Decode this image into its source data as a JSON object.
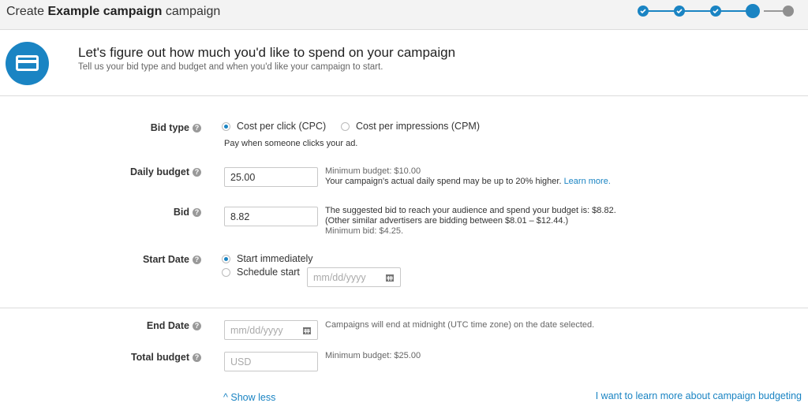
{
  "header": {
    "title_prefix": "Create",
    "campaign_name": "Example campaign",
    "title_suffix": "campaign",
    "steps": [
      {
        "state": "done"
      },
      {
        "state": "done"
      },
      {
        "state": "done"
      },
      {
        "state": "current"
      },
      {
        "state": "future"
      }
    ]
  },
  "intro": {
    "icon": "credit-card-icon",
    "heading": "Let's figure out how much you'd like to spend on your campaign",
    "subheading": "Tell us your bid type and budget and when you'd like your campaign to start."
  },
  "form": {
    "bid_type": {
      "label": "Bid type",
      "options": [
        "Cost per click (CPC)",
        "Cost per impressions (CPM)"
      ],
      "selected": "Cost per click (CPC)",
      "hint": "Pay when someone clicks your ad."
    },
    "daily_budget": {
      "label": "Daily budget",
      "value": "25.00",
      "hint_min": "Minimum budget: $10.00",
      "hint_text": "Your campaign's actual daily spend may be up to 20% higher.",
      "hint_link": "Learn more."
    },
    "bid": {
      "label": "Bid",
      "value": "8.82",
      "hint_line1": "The suggested bid to reach your audience and spend your budget is: $8.82.",
      "hint_line2": "(Other similar advertisers are bidding between $8.01 – $12.44.)",
      "hint_line3": "Minimum bid: $4.25."
    },
    "start_date": {
      "label": "Start Date",
      "options": [
        "Start immediately",
        "Schedule start"
      ],
      "selected": "Start immediately",
      "date_placeholder": "mm/dd/yyyy"
    },
    "end_date": {
      "label": "End Date",
      "placeholder": "mm/dd/yyyy",
      "hint": "Campaigns will end at midnight (UTC time zone) on the date selected."
    },
    "total_budget": {
      "label": "Total budget",
      "placeholder": "USD",
      "hint": "Minimum budget: $25.00"
    }
  },
  "footer": {
    "show_less": "Show less",
    "learn_budget": "I want to learn more about campaign budgeting"
  },
  "colors": {
    "accent": "#1a84c3",
    "inactive_step": "#8f8f8f"
  }
}
